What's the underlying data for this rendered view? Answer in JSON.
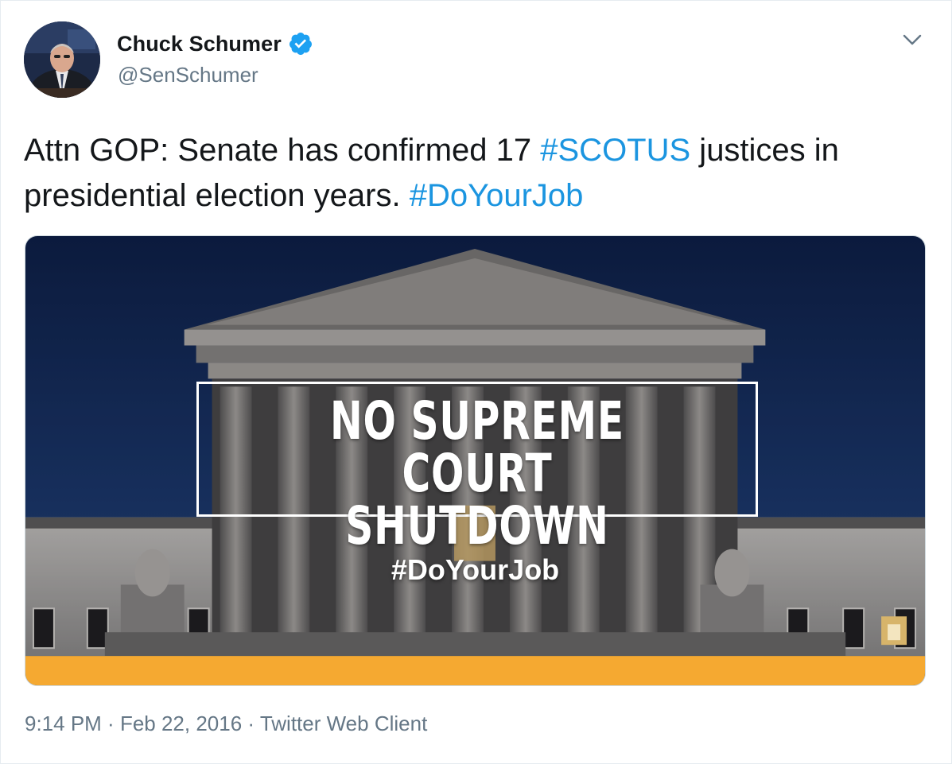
{
  "author": {
    "display_name": "Chuck Schumer",
    "handle": "@SenSchumer",
    "verified": true
  },
  "tweet": {
    "text_part1": "Attn GOP: Senate has confirmed 17 ",
    "hashtag1": "#SCOTUS",
    "text_part2": " justices in presidential election years. ",
    "hashtag2": "#DoYourJob"
  },
  "media": {
    "headline_line1": "NO SUPREME COURT",
    "headline_line2": "SHUTDOWN",
    "hashtag": "#DoYourJob",
    "band_color": "#f5a931",
    "sky_color": "#0f2148"
  },
  "footer": {
    "time": "9:14 PM",
    "separator1": " · ",
    "date": "Feb 22, 2016",
    "separator2": " · ",
    "client": "Twitter Web Client"
  },
  "icons": {
    "verified": "verified-badge-icon",
    "caret": "chevron-down-icon"
  },
  "colors": {
    "link": "#1b95e0",
    "verified": "#1da1f2",
    "secondary_text": "#657786",
    "primary_text": "#14171a"
  }
}
